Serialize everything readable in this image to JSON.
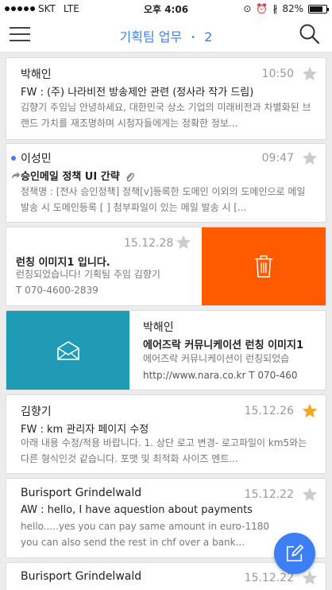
{
  "status": {
    "carrier": "SKT",
    "network": "LTE",
    "time": "오후 4:06",
    "battery": "82%",
    "battery_level": 0.82
  },
  "nav": {
    "title": "기획팀 업무",
    "separator": "•",
    "count": "2"
  },
  "emails": [
    {
      "sender": "박해인",
      "time": "10:50",
      "subject": "FW : (주) 나라비전 방송제안 관련 (정사라 작가 드림)",
      "preview": "김향기 주임님 안녕하세요, 대한민국 상소 기업의 미래비전과 차별화된 브랜드 가치를 재조명하며 시청자들에게는 정확한 정보...",
      "starred": false
    },
    {
      "sender": "이성민",
      "time": "09:47",
      "subject": "승인메일 정책 UI 간략",
      "preview": "정책명 : [전사 승인정책] 정책[v]등록한 도메인 이외의 도메인으로 메일 발송 시 도메인등록 [ ] 첨부파일이 있는 메일 발송 시 [...",
      "starred": false,
      "unread": true
    },
    {
      "sender": "",
      "time": "15.12.28",
      "subject": "런칭 이미지1 입니다.",
      "preview_lines": [
        "런칭되었습니다! 기획팀 주임 김향기",
        "T 070-4600-2839"
      ],
      "starred": false
    },
    {
      "sender": "박해인",
      "subject": "에어즈락 커뮤니케이션 런칭 이미지1",
      "preview_lines": [
        "에어즈락 커뮤니케이션이 런칭되었습",
        "http://www.nara.co.kr  T 070-460"
      ]
    },
    {
      "sender": "김향기",
      "time": "15.12.26",
      "subject": "FW : km 관리자 페이지 수정",
      "preview": "아래 내용 수정/적용 바랍니다. 1. 상단 로고 변경- 로고파일이 km5와는 다른 형식인것 같습니다. 포맷 및 최적화 사이즈 멘트...",
      "starred": true
    },
    {
      "sender": "Burisport Grindelwald",
      "time": "15.12.22",
      "subject": "AW : hello, I have aquestion about payments",
      "preview": "hello.....yes you can pay same amount in euro-1180 you can also send the rest in chf over a bank...",
      "starred": false
    },
    {
      "sender": "Burisport Grindelwald",
      "time": "15.12.22"
    }
  ],
  "colors": {
    "accent": "#3d7ef5",
    "delete": "#ff5a00",
    "mark_read": "#1f9bb5",
    "star_on": "#f5a623",
    "star_off": "#cccccc"
  },
  "icons": {
    "menu": "hamburger-icon",
    "search": "search-icon",
    "star": "star-icon",
    "attachment": "paperclip-icon",
    "forward": "forward-icon",
    "delete": "trash-icon",
    "read": "envelope-open-icon",
    "compose": "compose-icon"
  }
}
